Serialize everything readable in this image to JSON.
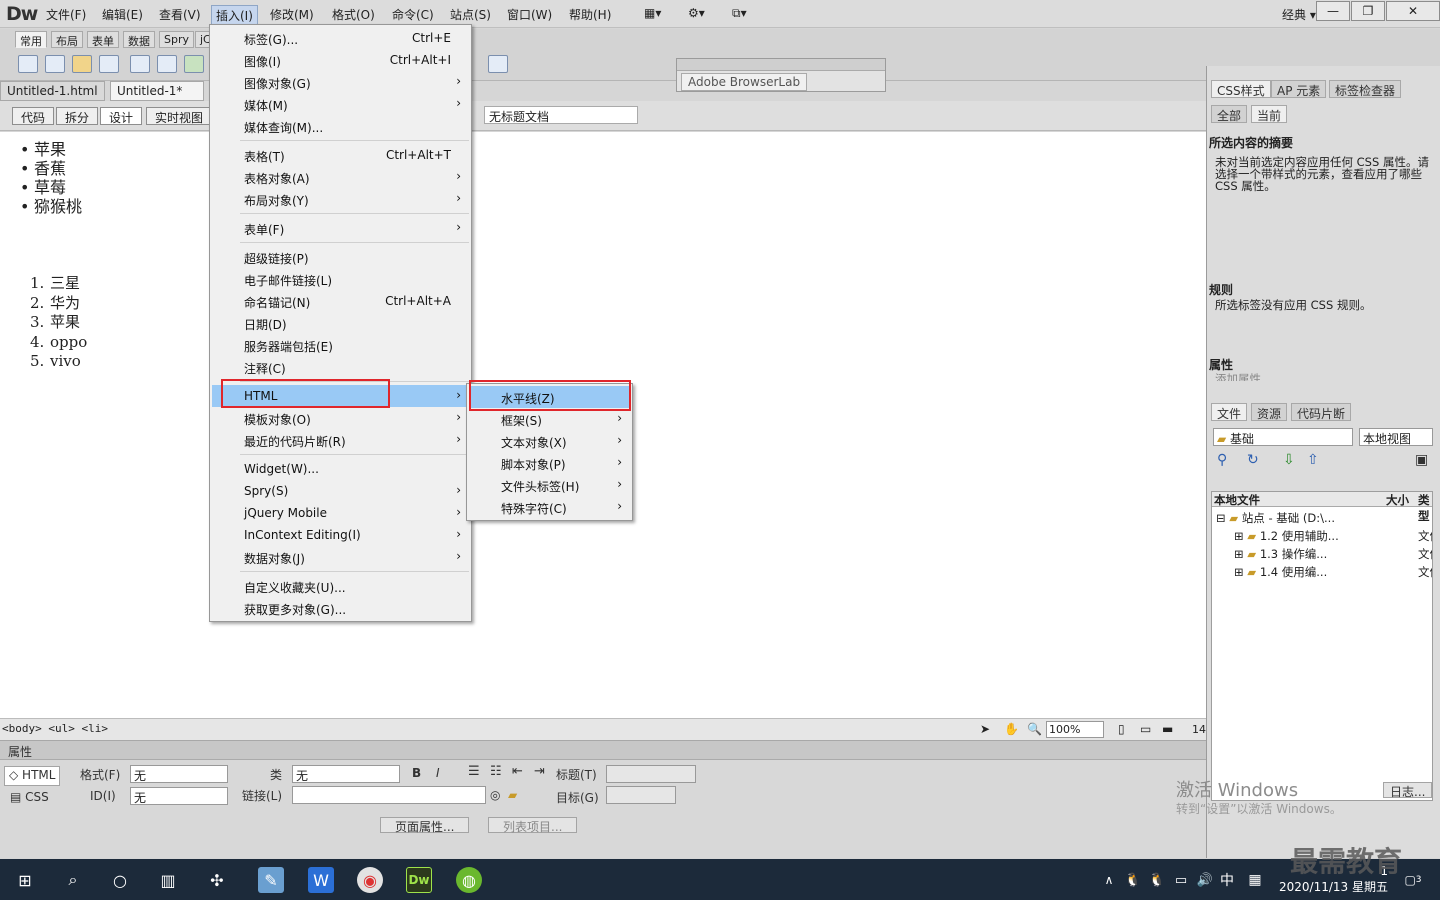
{
  "app": {
    "logo": "Dw",
    "layout_mode": "经典"
  },
  "menubar": [
    "文件(F)",
    "编辑(E)",
    "查看(V)",
    "插入(I)",
    "修改(M)",
    "格式(O)",
    "命令(C)",
    "站点(S)",
    "窗口(W)",
    "帮助(H)"
  ],
  "insert_tabs": [
    "常用",
    "布局",
    "表单",
    "数据",
    "Spry",
    "jC"
  ],
  "doc_tabs": [
    "Untitled-1.html",
    "Untitled-1*"
  ],
  "view_buttons": [
    "代码",
    "拆分",
    "设计",
    "实时视图"
  ],
  "doc_title_value": "无标题文档",
  "browserlab_tab": "Adobe BrowserLab",
  "content": {
    "ul": [
      "苹果",
      "香蕉",
      "草莓",
      "猕猴桃"
    ],
    "ol": [
      {
        "n": "1.",
        "t": "三星"
      },
      {
        "n": "2.",
        "t": "华为"
      },
      {
        "n": "3.",
        "t": "苹果"
      },
      {
        "n": "4.",
        "t": "oppo"
      },
      {
        "n": "5.",
        "t": "vivo"
      }
    ]
  },
  "insert_menu": [
    {
      "label": "标签(G)...",
      "shortcut": "Ctrl+E"
    },
    {
      "label": "图像(I)",
      "shortcut": "Ctrl+Alt+I"
    },
    {
      "label": "图像对象(G)",
      "arrow": "›"
    },
    {
      "label": "媒体(M)",
      "arrow": "›"
    },
    {
      "label": "媒体查询(M)..."
    },
    {
      "label": "表格(T)",
      "shortcut": "Ctrl+Alt+T"
    },
    {
      "label": "表格对象(A)",
      "arrow": "›"
    },
    {
      "label": "布局对象(Y)",
      "arrow": "›"
    },
    {
      "label": "表单(F)",
      "arrow": "›"
    },
    {
      "label": "超级链接(P)"
    },
    {
      "label": "电子邮件链接(L)"
    },
    {
      "label": "命名锚记(N)",
      "shortcut": "Ctrl+Alt+A"
    },
    {
      "label": "日期(D)"
    },
    {
      "label": "服务器端包括(E)"
    },
    {
      "label": "注释(C)"
    },
    {
      "label": "HTML",
      "arrow": "›"
    },
    {
      "label": "模板对象(O)",
      "arrow": "›"
    },
    {
      "label": "最近的代码片断(R)",
      "arrow": "›"
    },
    {
      "label": "Widget(W)..."
    },
    {
      "label": "Spry(S)",
      "arrow": "›"
    },
    {
      "label": "jQuery Mobile",
      "arrow": "›"
    },
    {
      "label": "InContext Editing(I)",
      "arrow": "›"
    },
    {
      "label": "数据对象(J)",
      "arrow": "›"
    },
    {
      "label": "自定义收藏夹(U)..."
    },
    {
      "label": "获取更多对象(G)..."
    }
  ],
  "html_submenu": [
    {
      "label": "水平线(Z)"
    },
    {
      "label": "框架(S)",
      "arrow": "›"
    },
    {
      "label": "文本对象(X)",
      "arrow": "›"
    },
    {
      "label": "脚本对象(P)",
      "arrow": "›"
    },
    {
      "label": "文件头标签(H)",
      "arrow": "›"
    },
    {
      "label": "特殊字符(C)",
      "arrow": "›"
    }
  ],
  "status": {
    "tag_selector": "<body> <ul> <li>",
    "zoom": "100%",
    "width_hint": "14"
  },
  "properties": {
    "header": "属性",
    "html_btn": "HTML",
    "css_btn": "CSS",
    "format_label": "格式(F)",
    "format_value": "无",
    "id_label": "ID(I)",
    "id_value": "无",
    "class_label": "类",
    "class_value": "无",
    "link_label": "链接(L)",
    "title_label": "标题(T)",
    "target_label": "目标(G)",
    "bold": "B",
    "italic": "I",
    "page_props_btn": "页面属性...",
    "list_item_btn": "列表项目..."
  },
  "right_panel": {
    "css_tabs": [
      "CSS样式",
      "AP 元素",
      "标签检查器"
    ],
    "mode_tabs": [
      "全部",
      "当前"
    ],
    "summary_title": "所选内容的摘要",
    "summary_text": "未对当前选定内容应用任何 CSS 属性。请选择一个带样式的元素，查看应用了哪些 CSS 属性。",
    "rules_title": "规则",
    "rules_text": "所选标签没有应用 CSS 规则。",
    "props_title": "属性",
    "props_add": "添加属性",
    "file_tabs": [
      "文件",
      "资源",
      "代码片断"
    ],
    "site_select": "基础",
    "view_select": "本地视图",
    "file_cols": [
      "本地文件",
      "大小",
      "类型"
    ],
    "files": [
      {
        "name": "站点 - 基础 (D:\\...",
        "type": ""
      },
      {
        "name": "1.2 使用辅助...",
        "type": "文件"
      },
      {
        "name": "1.3 操作编...",
        "type": "文件"
      },
      {
        "name": "1.4 使用编...",
        "type": "文件"
      }
    ],
    "log_btn": "日志..."
  },
  "watermark": {
    "line1": "激活 Windows",
    "line2": "转到“设置”以激活 Windows。",
    "brand": "最需教育"
  },
  "taskbar": {
    "time": "1",
    "date": "2020/11/13 星期五",
    "ime": "中",
    "badge": "3"
  }
}
